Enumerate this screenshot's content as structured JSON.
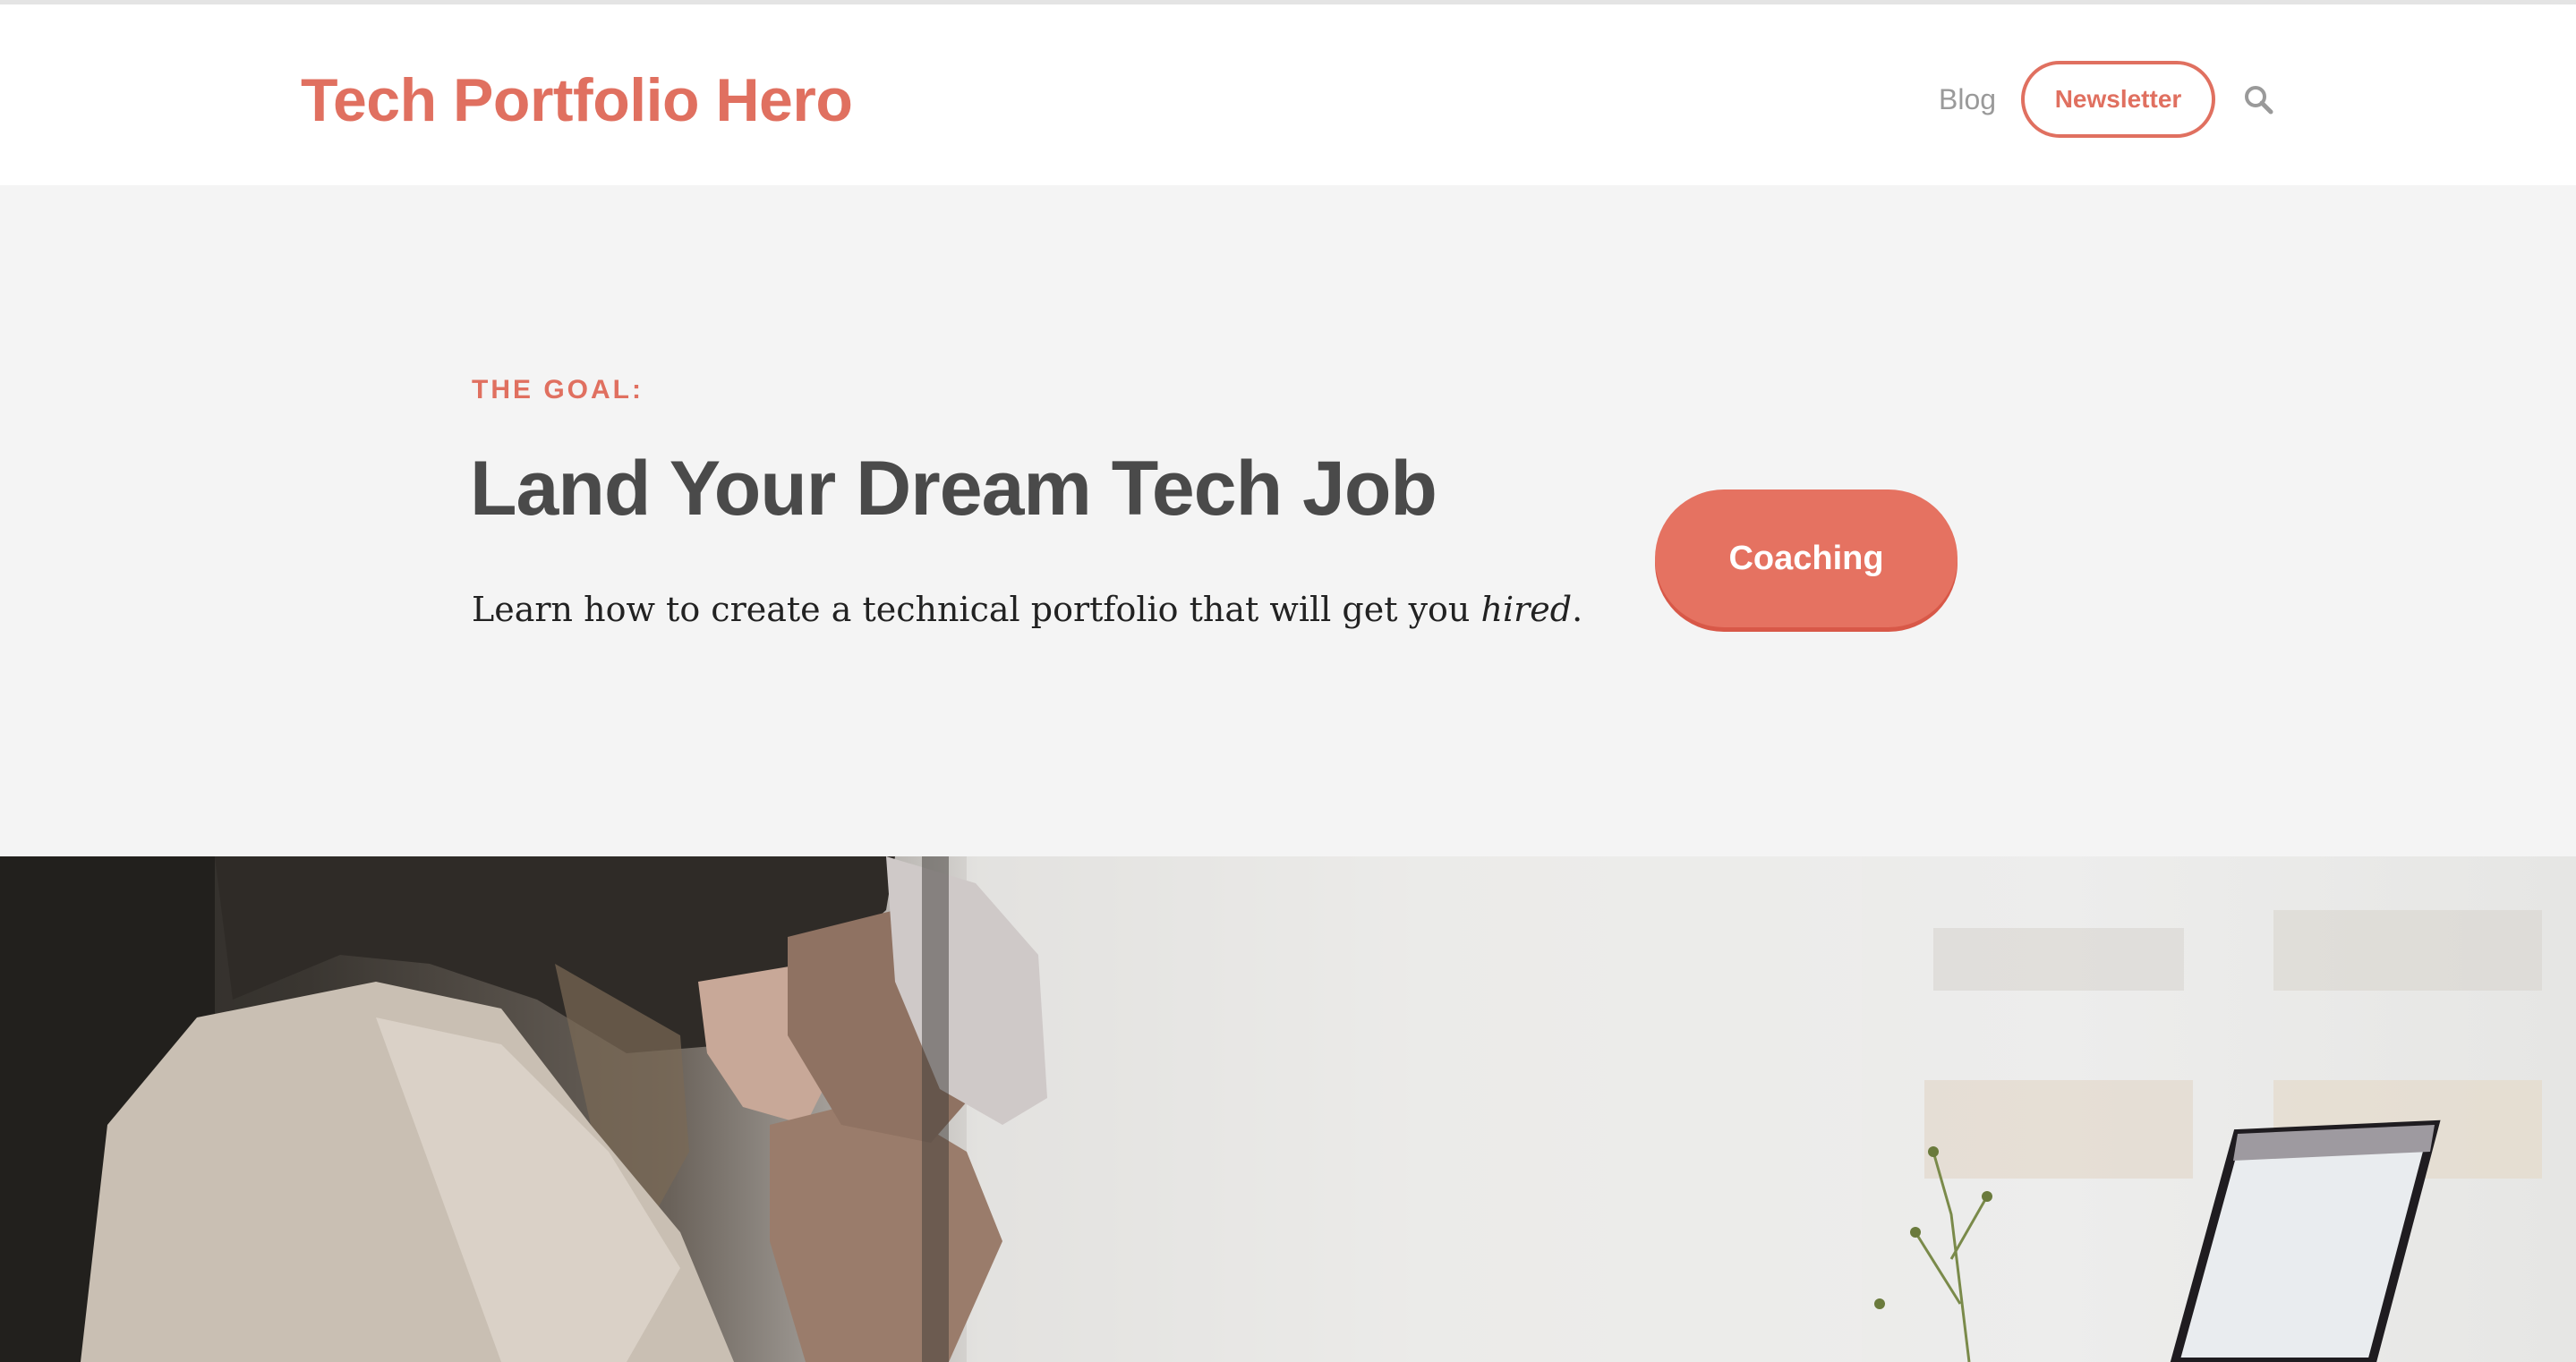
{
  "header": {
    "site_title": "Tech Portfolio Hero",
    "nav": {
      "blog_label": "Blog",
      "newsletter_label": "Newsletter"
    },
    "search_icon": "search-icon"
  },
  "hero": {
    "kicker": "THE GOAL:",
    "title": "Land Your Dream Tech Job",
    "subtitle_prefix": "Learn how to create  a technical portfolio that will get you ",
    "subtitle_emphasis": "hired",
    "subtitle_suffix": ".",
    "cta_label": "Coaching"
  },
  "colors": {
    "accent": "#e07060",
    "button_fill": "#e57261",
    "hero_bg": "#f4f4f4",
    "heading_text": "#4a4a4a",
    "nav_text": "#9a9a9a"
  }
}
